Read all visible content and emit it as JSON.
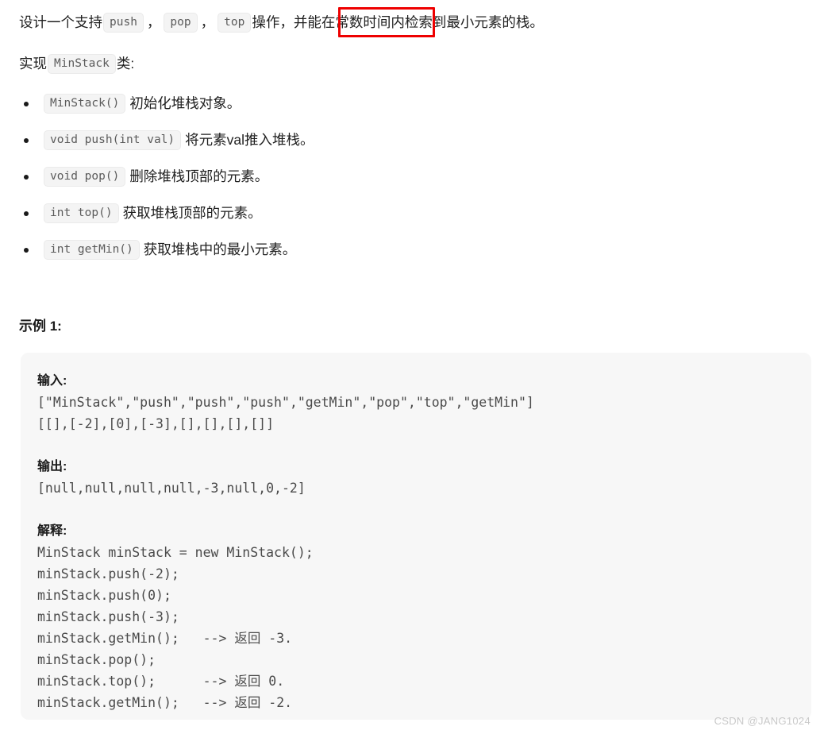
{
  "document": {
    "intro": {
      "before_push": "设计一个支持",
      "chips": [
        "push",
        "pop",
        "top"
      ],
      "separator": "，",
      "after_top": "操作，并能在",
      "highlighted": "常数时间内检",
      "tail": "索到最小元素的栈。"
    },
    "implement_line": {
      "prefix": "实现",
      "chip": "MinStack",
      "suffix": "类:"
    },
    "methods": [
      {
        "signature": "MinStack()",
        "description": "初始化堆栈对象。"
      },
      {
        "signature": "void push(int val)",
        "description": "将元素val推入堆栈。"
      },
      {
        "signature": "void pop()",
        "description": "删除堆栈顶部的元素。"
      },
      {
        "signature": "int top()",
        "description": "获取堆栈顶部的元素。"
      },
      {
        "signature": "int getMin()",
        "description": "获取堆栈中的最小元素。"
      }
    ],
    "example": {
      "heading": "示例 1:",
      "input_label": "输入:",
      "input_lines": [
        "[\"MinStack\",\"push\",\"push\",\"push\",\"getMin\",\"pop\",\"top\",\"getMin\"]",
        "[[],[-2],[0],[-3],[],[],[],[]]"
      ],
      "output_label": "输出:",
      "output_lines": [
        "[null,null,null,null,-3,null,0,-2]"
      ],
      "explanation_label": "解释:",
      "explanation_lines": [
        "MinStack minStack = new MinStack();",
        "minStack.push(-2);",
        "minStack.push(0);",
        "minStack.push(-3);",
        "minStack.getMin();   --> 返回 -3.",
        "minStack.pop();",
        "minStack.top();      --> 返回 0.",
        "minStack.getMin();   --> 返回 -2."
      ]
    }
  },
  "annotation": {
    "color": "#ee0000",
    "kind": "rectangle-highlight"
  },
  "watermark": {
    "text": "CSDN @JANG1024"
  }
}
